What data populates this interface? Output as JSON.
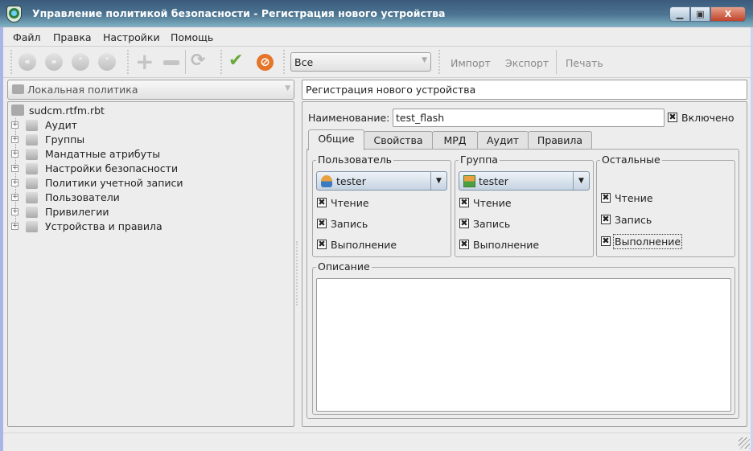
{
  "window": {
    "title": "Управление политикой безопасности - Регистрация нового устройства",
    "minimize": "▁",
    "maximize": "▣",
    "close": "X"
  },
  "menu": [
    "Файл",
    "Правка",
    "Настройки",
    "Помощь"
  ],
  "toolbar": {
    "filter_value": "Все",
    "import": "Импорт",
    "export": "Экспорт",
    "print": "Печать"
  },
  "left": {
    "policy_combo": "Локальная политика",
    "root": "sudcm.rtfm.rbt",
    "items": [
      "Аудит",
      "Группы",
      "Мандатные атрибуты",
      "Настройки безопасности",
      "Политики учетной записи",
      "Пользователи",
      "Привилегии",
      "Устройства и правила"
    ]
  },
  "right": {
    "title": "Регистрация нового устройства",
    "name_label": "Наименование:",
    "name_value": "test_flash",
    "enabled_label": "Включено",
    "tabs": [
      "Общие",
      "Свойства",
      "МРД",
      "Аудит",
      "Правила"
    ],
    "user": {
      "legend": "Пользователь",
      "value": "tester"
    },
    "group": {
      "legend": "Группа",
      "value": "tester"
    },
    "other": {
      "legend": "Остальные"
    },
    "perms": {
      "read": "Чтение",
      "write": "Запись",
      "exec": "Выполнение"
    },
    "description_legend": "Описание",
    "check_mark": "✖"
  }
}
